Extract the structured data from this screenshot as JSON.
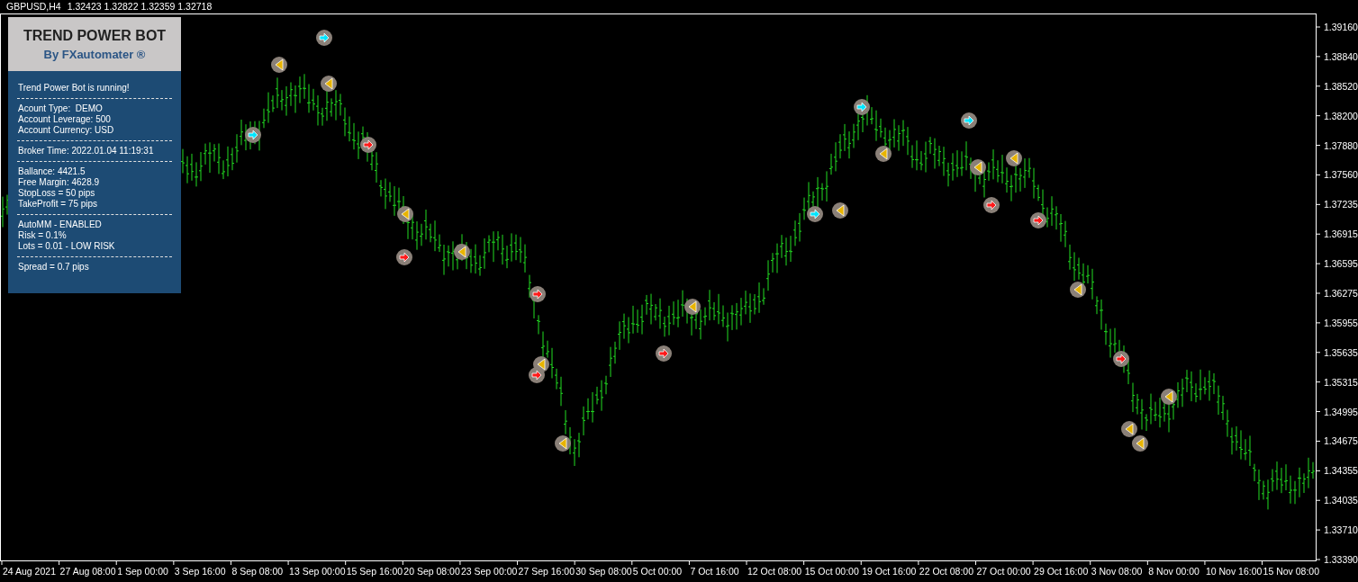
{
  "chart_header": {
    "symbol": "GBPUSD,H4",
    "quotes": "1.32423 1.32822 1.32359 1.32718"
  },
  "panel": {
    "title": "TREND POWER BOT",
    "subtitle": "By FXautomater ®",
    "sections": [
      [
        "Trend Power Bot is running!"
      ],
      [
        "Acount Type:  DEMO",
        "Account Leverage: 500",
        "Account Currency: USD"
      ],
      [
        "Broker Time: 2022.01.04 11:19:31"
      ],
      [
        "Ballance: 4421.5",
        "Free Margin: 4628.9",
        "StopLoss = 50 pips",
        "TakeProfit = 75 pips"
      ],
      [
        "AutoMM - ENABLED",
        "Risk = 0.1%",
        "Lots = 0.01 - LOW RISK"
      ],
      [
        "Spread = 0.7 pips"
      ]
    ]
  },
  "price_axis": [
    "1.39160",
    "1.38840",
    "1.38520",
    "1.38200",
    "1.37880",
    "1.37560",
    "1.37235",
    "1.36915",
    "1.36595",
    "1.36275",
    "1.35955",
    "1.35635",
    "1.35315",
    "1.34995",
    "1.34675",
    "1.34355",
    "1.34035",
    "1.33710",
    "1.33390"
  ],
  "time_axis": [
    "24 Aug 2021",
    "27 Aug 08:00",
    "1 Sep 00:00",
    "3 Sep 16:00",
    "8 Sep 08:00",
    "13 Sep 00:00",
    "15 Sep 16:00",
    "20 Sep 08:00",
    "23 Sep 00:00",
    "27 Sep 16:00",
    "30 Sep 08:00",
    "5 Oct 00:00",
    "7 Oct 16:00",
    "12 Oct 08:00",
    "15 Oct 00:00",
    "19 Oct 16:00",
    "22 Oct 08:00",
    "27 Oct 00:00",
    "29 Oct 16:00",
    "3 Nov 08:00",
    "8 Nov 00:00",
    "10 Nov 16:00",
    "15 Nov 08:00"
  ]
}
